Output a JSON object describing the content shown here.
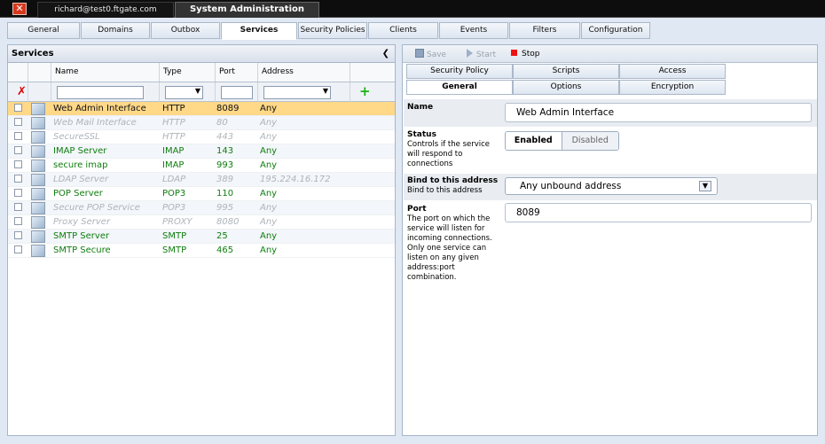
{
  "window": {
    "close_glyph": "✕",
    "user": "richard@test0.ftgate.com",
    "title": "System Administration"
  },
  "nav_tabs": [
    "General",
    "Domains",
    "Outbox",
    "Services",
    "Security Policies",
    "Clients",
    "Events",
    "Filters",
    "Configuration"
  ],
  "active_nav_tab": "Services",
  "services_panel": {
    "title": "Services",
    "columns": {
      "name": "Name",
      "type": "Type",
      "port": "Port",
      "address": "Address"
    },
    "rows": [
      {
        "name": "Web Admin Interface",
        "type": "HTTP",
        "port": "8089",
        "address": "Any",
        "enabled": true,
        "selected": true,
        "icon": "web-service-icon"
      },
      {
        "name": "Web Mail Interface",
        "type": "HTTP",
        "port": "80",
        "address": "Any",
        "enabled": false,
        "icon": "web-service-icon"
      },
      {
        "name": "SecureSSL",
        "type": "HTTP",
        "port": "443",
        "address": "Any",
        "enabled": false,
        "icon": "web-service-icon"
      },
      {
        "name": "IMAP Server",
        "type": "IMAP",
        "port": "143",
        "address": "Any",
        "enabled": true,
        "icon": "mail-service-icon"
      },
      {
        "name": "secure imap",
        "type": "IMAP",
        "port": "993",
        "address": "Any",
        "enabled": true,
        "icon": "mail-service-icon"
      },
      {
        "name": "LDAP Server",
        "type": "LDAP",
        "port": "389",
        "address": "195.224.16.172",
        "enabled": false,
        "icon": "ldap-service-icon"
      },
      {
        "name": "POP Server",
        "type": "POP3",
        "port": "110",
        "address": "Any",
        "enabled": true,
        "icon": "mail-service-icon"
      },
      {
        "name": "Secure POP Service",
        "type": "POP3",
        "port": "995",
        "address": "Any",
        "enabled": false,
        "icon": "mail-service-icon"
      },
      {
        "name": "Proxy Server",
        "type": "PROXY",
        "port": "8080",
        "address": "Any",
        "enabled": false,
        "icon": "proxy-service-icon"
      },
      {
        "name": "SMTP Server",
        "type": "SMTP",
        "port": "25",
        "address": "Any",
        "enabled": true,
        "icon": "smtp-service-icon"
      },
      {
        "name": "SMTP Secure",
        "type": "SMTP",
        "port": "465",
        "address": "Any",
        "enabled": true,
        "icon": "smtp-service-icon"
      }
    ]
  },
  "toolbar": {
    "save": "Save",
    "start": "Start",
    "stop": "Stop"
  },
  "sub_tabs": {
    "row1": [
      "Security Policy",
      "Scripts",
      "Access"
    ],
    "row2": [
      "General",
      "Options",
      "Encryption"
    ],
    "active": "General"
  },
  "form": {
    "name_label": "Name",
    "name_value": "Web Admin Interface",
    "status_label": "Status",
    "status_desc": "Controls if the service will respond to connections",
    "status_enabled": "Enabled",
    "status_disabled": "Disabled",
    "bind_label": "Bind to this address",
    "bind_desc": "Bind to this address",
    "bind_value": "Any unbound address",
    "port_label": "Port",
    "port_desc": "The port on which the service will listen for incoming connections. Only one service can listen on any given address:port combination.",
    "port_value": "8089"
  }
}
